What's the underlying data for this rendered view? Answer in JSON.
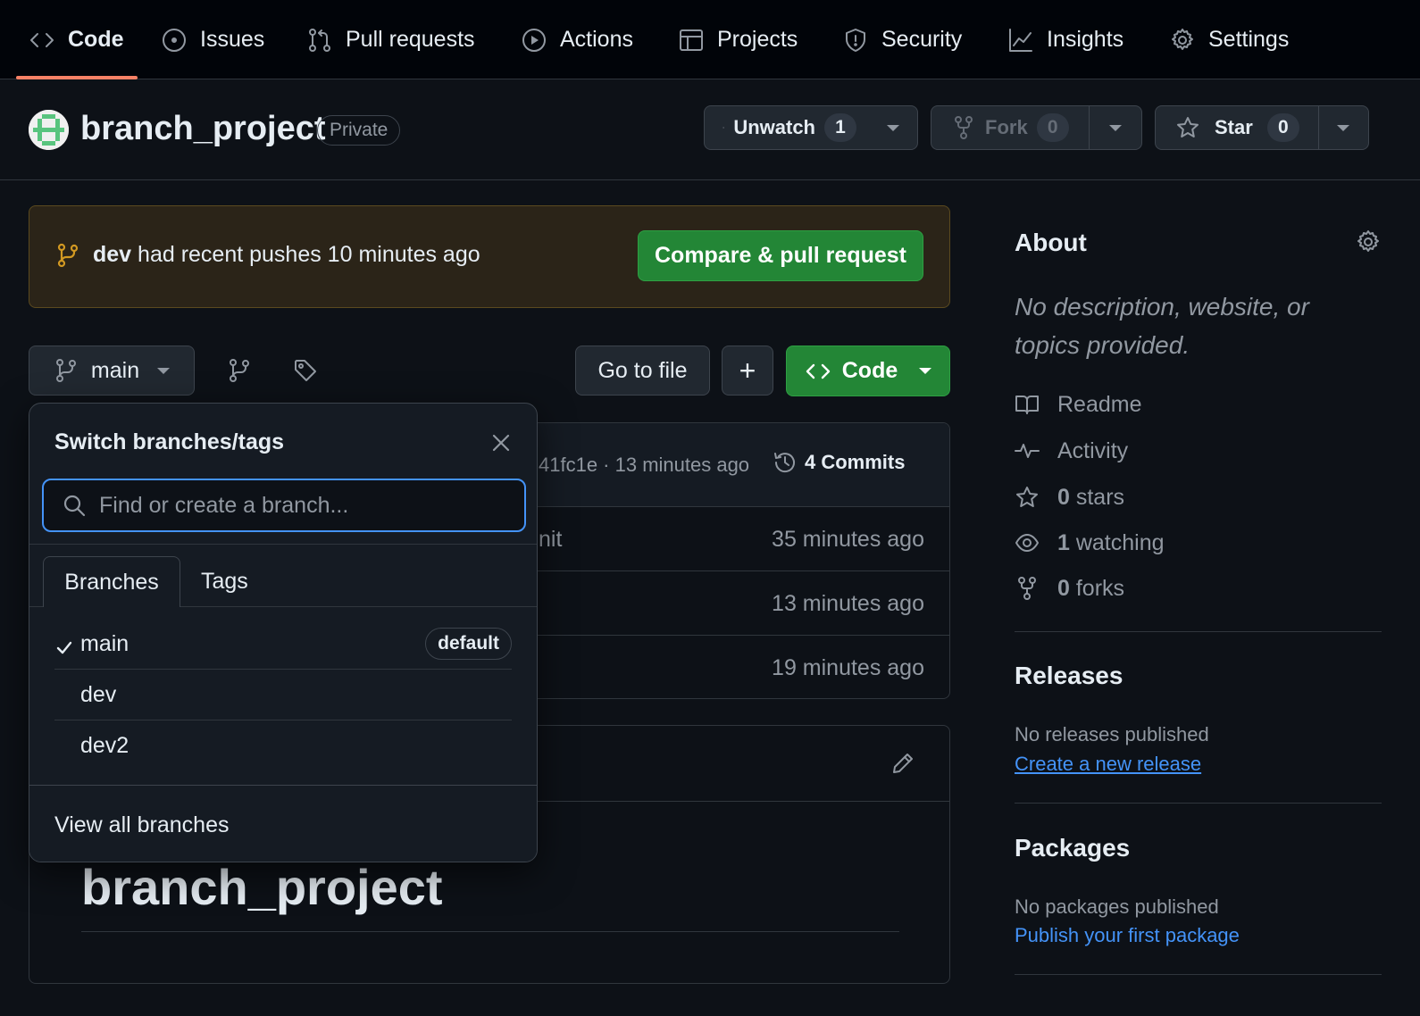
{
  "nav": {
    "items": [
      {
        "label": "Code",
        "icon": "code-icon"
      },
      {
        "label": "Issues",
        "icon": "issue-opened-icon"
      },
      {
        "label": "Pull requests",
        "icon": "git-pull-request-icon"
      },
      {
        "label": "Actions",
        "icon": "play-icon"
      },
      {
        "label": "Projects",
        "icon": "table-icon"
      },
      {
        "label": "Security",
        "icon": "shield-icon"
      },
      {
        "label": "Insights",
        "icon": "graph-icon"
      },
      {
        "label": "Settings",
        "icon": "gear-icon"
      }
    ],
    "active": "Code"
  },
  "repo": {
    "name": "branch_project",
    "visibility": "Private",
    "unwatch_label": "Unwatch",
    "watch_count": "1",
    "fork_label": "Fork",
    "fork_count": "0",
    "star_label": "Star",
    "star_count": "0"
  },
  "banner": {
    "branch": "dev",
    "text": " had recent pushes 10 minutes ago",
    "button": "Compare & pull request"
  },
  "toolbar": {
    "branch": "main",
    "go_to_file": "Go to file",
    "add": "+",
    "code": "Code"
  },
  "commit_bar": {
    "hash_time": "41fc1e · 13 minutes ago",
    "commits": "4 Commits"
  },
  "file_rows": [
    {
      "partial": "nit",
      "time": "35 minutes ago"
    },
    {
      "partial": "",
      "time": "13 minutes ago"
    },
    {
      "partial": "",
      "time": "19 minutes ago"
    }
  ],
  "readme": {
    "heading": "branch_project"
  },
  "dropdown": {
    "title": "Switch branches/tags",
    "search_placeholder": "Find or create a branch...",
    "tabs": [
      "Branches",
      "Tags"
    ],
    "branches": [
      {
        "name": "main",
        "selected": true,
        "badge": "default"
      },
      {
        "name": "dev",
        "selected": false
      },
      {
        "name": "dev2",
        "selected": false
      }
    ],
    "footer": "View all branches"
  },
  "sidebar": {
    "about_heading": "About",
    "description": "No description, website, or topics provided.",
    "links": [
      {
        "label": "Readme",
        "icon": "book-icon"
      },
      {
        "label": "Activity",
        "icon": "pulse-icon"
      },
      {
        "count": "0",
        "label": " stars",
        "icon": "star-icon"
      },
      {
        "count": "1",
        "label": " watching",
        "icon": "eye-icon"
      },
      {
        "count": "0",
        "label": " forks",
        "icon": "repo-forked-icon"
      }
    ],
    "releases_heading": "Releases",
    "releases_empty": "No releases published",
    "releases_link": "Create a new release",
    "packages_heading": "Packages",
    "packages_empty": "No packages published",
    "packages_link": "Publish your first package"
  },
  "colors": {
    "accent_green": "#238636",
    "link_blue": "#4493f8",
    "nav_underline": "#f78166",
    "banner_icon": "#d29922"
  }
}
